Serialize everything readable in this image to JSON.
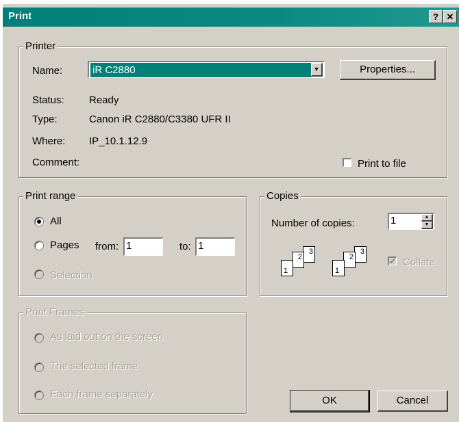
{
  "window": {
    "title": "Print",
    "help_label": "?",
    "close_label": "✕"
  },
  "printer": {
    "legend": "Printer",
    "name_label": "Name:",
    "name_value": "iR C2880",
    "properties_label": "Properties...",
    "status_label": "Status:",
    "status_value": "Ready",
    "type_label": "Type:",
    "type_value": "Canon iR C2880/C3380 UFR II",
    "where_label": "Where:",
    "where_value": "IP_10.1.12.9",
    "comment_label": "Comment:",
    "print_to_file_label": "Print to file",
    "print_to_file_checked": false
  },
  "print_range": {
    "legend": "Print range",
    "all_label": "All",
    "pages_label": "Pages",
    "from_label": "from:",
    "from_value": "1",
    "to_label": "to:",
    "to_value": "1",
    "selection_label": "Selection",
    "selected": "All"
  },
  "copies": {
    "legend": "Copies",
    "number_label": "Number of copies:",
    "number_value": "1",
    "collate_label": "Collate",
    "collate_checked": true,
    "page_numbers": [
      "1",
      "2",
      "3"
    ]
  },
  "print_frames": {
    "legend": "Print Frames",
    "options": [
      "As laid out on the screen",
      "The selected frame",
      "Each frame separately"
    ]
  },
  "buttons": {
    "ok": "OK",
    "cancel": "Cancel"
  },
  "colors": {
    "titlebar": "#008077",
    "face": "#d4d0c8",
    "selection": "#008077"
  }
}
